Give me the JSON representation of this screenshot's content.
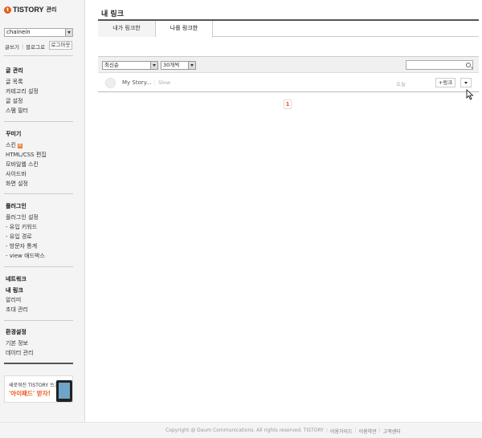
{
  "brand": {
    "logo_text": "TISTORY",
    "logo_sub": "관리"
  },
  "blog_select": {
    "value": "chainein"
  },
  "quick_links": {
    "write": "글쓰기",
    "blog": "블로그로",
    "logout": "로그아웃"
  },
  "sidebar": {
    "sections": [
      {
        "title": "글 관리",
        "items": [
          {
            "label": "글 목록"
          },
          {
            "label": "카테고리 설정"
          },
          {
            "label": "글 설정"
          },
          {
            "label": "스팸 필터"
          }
        ]
      },
      {
        "title": "꾸미기",
        "items": [
          {
            "label": "스킨",
            "badge": "N"
          },
          {
            "label": "HTML/CSS 편집"
          },
          {
            "label": "모바일웹 스킨"
          },
          {
            "label": "사이드바"
          },
          {
            "label": "화면 설정"
          }
        ]
      },
      {
        "title": "플러그인",
        "items": [
          {
            "label": "플러그인 설정"
          },
          {
            "label": "- 유입 키워드"
          },
          {
            "label": "- 유입 경로"
          },
          {
            "label": "- 방문자 통계"
          },
          {
            "label": "- view 애드박스"
          }
        ]
      },
      {
        "title": "네트워크",
        "items": [
          {
            "label": "내 링크"
          },
          {
            "label": "알리미"
          },
          {
            "label": "초대 관리"
          }
        ]
      },
      {
        "title": "환경설정",
        "items": [
          {
            "label": "기본 정보"
          },
          {
            "label": "데이터 관리"
          }
        ]
      }
    ]
  },
  "banner": {
    "line1": "새로워진 TISTORY 쓰고",
    "line2": "'아이패드' 받자!"
  },
  "main": {
    "title": "내 링크",
    "tabs": [
      {
        "label": "내가 링크한"
      },
      {
        "label": "나를 링크한"
      }
    ],
    "filters": {
      "sort": "최신순",
      "count": "30개씩",
      "search_value": ""
    },
    "rows": [
      {
        "title": "My Story...",
        "sub": "Slow",
        "meta": "오늘",
        "link_button": "+링크"
      }
    ],
    "pagination": {
      "current": "1"
    }
  },
  "footer": {
    "copyright": "Copyright @ Daum Communications. All rights reserved. TISTORY",
    "links": [
      "이용가이드",
      "이용약관",
      "고객센터"
    ]
  },
  "colors": {
    "accent": "#e85a1c"
  }
}
